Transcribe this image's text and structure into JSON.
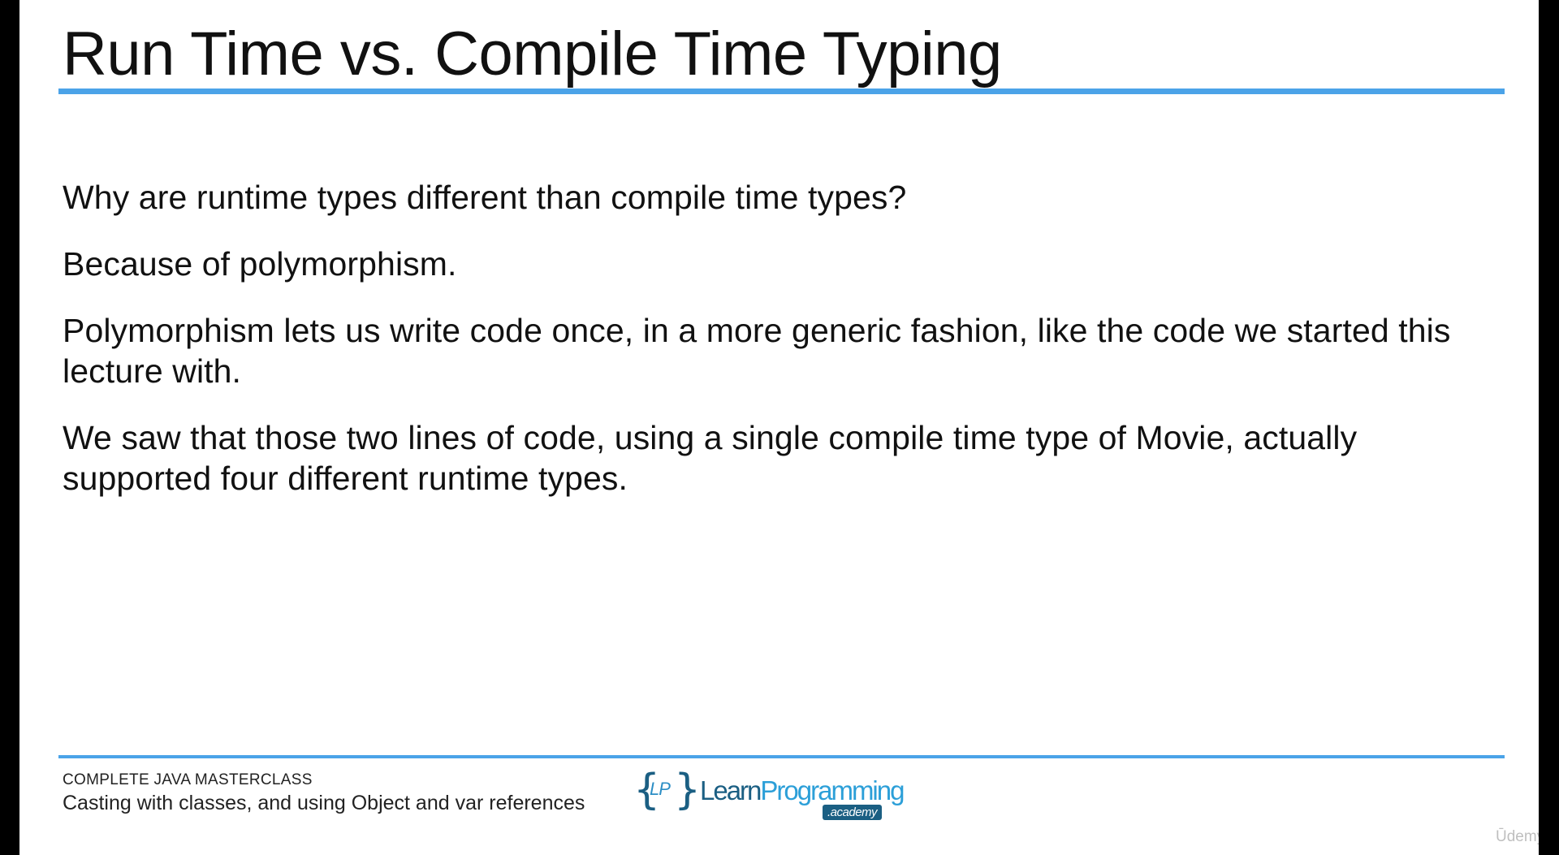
{
  "slide": {
    "title": "Run Time vs. Compile Time Typing",
    "paragraphs": [
      "Why are runtime types different than compile time types?",
      "Because of polymorphism.",
      "Polymorphism lets us write code once, in a more generic fashion, like the code we started this lecture with.",
      "We saw that those two lines of code, using a single compile time type of Movie, actually supported four different runtime types."
    ]
  },
  "footer": {
    "course": "COMPLETE JAVA MASTERCLASS",
    "lecture": "Casting with classes, and using Object and var references",
    "logo": {
      "brace_open": "{",
      "initials": "LP",
      "brace_close": "}",
      "word_learn": "Learn",
      "word_programming": "Programming",
      "tag": ".academy"
    }
  },
  "watermark": "Ūdemy",
  "colors": {
    "accent_rule": "#4ba3e8",
    "logo_dark": "#1b5f83",
    "logo_light": "#2c9fd8",
    "background": "#ffffff",
    "letterbox": "#000000"
  }
}
